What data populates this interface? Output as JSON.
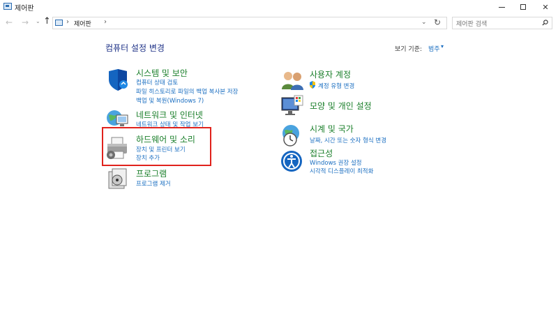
{
  "window": {
    "title": "제어판"
  },
  "nav": {
    "breadcrumb": "제어판",
    "search_placeholder": "제어판 검색"
  },
  "header": {
    "title": "컴퓨터 설정 변경",
    "view_label": "보기 기준:",
    "view_value": "범주"
  },
  "left_categories": [
    {
      "title": "시스템 및 보안",
      "links": [
        "컴퓨터 상태 검토",
        "파일 히스토리로 파일의 백업 복사본 저장",
        "백업 및 복원(Windows 7)"
      ]
    },
    {
      "title": "네트워크 및 인터넷",
      "links": [
        "네트워크 상태 및 작업 보기"
      ]
    },
    {
      "title": "하드웨어 및 소리",
      "links": [
        "장치 및 프린터 보기",
        "장치 추가"
      ]
    },
    {
      "title": "프로그램",
      "links": [
        "프로그램 제거"
      ]
    }
  ],
  "right_categories": [
    {
      "title": "사용자 계정",
      "links": [
        "계정 유형 변경"
      ]
    },
    {
      "title": "모양 및 개인 설정",
      "links": []
    },
    {
      "title": "시계 및 국가",
      "links": [
        "날짜, 시간 또는 숫자 형식 변경"
      ]
    },
    {
      "title": "접근성",
      "links": [
        "Windows 권장 설정",
        "시각적 디스플레이 최적화"
      ]
    }
  ],
  "colors": {
    "category_title": "#1a7f2a",
    "link": "#1a6ec1",
    "highlight": "#e0221c"
  }
}
